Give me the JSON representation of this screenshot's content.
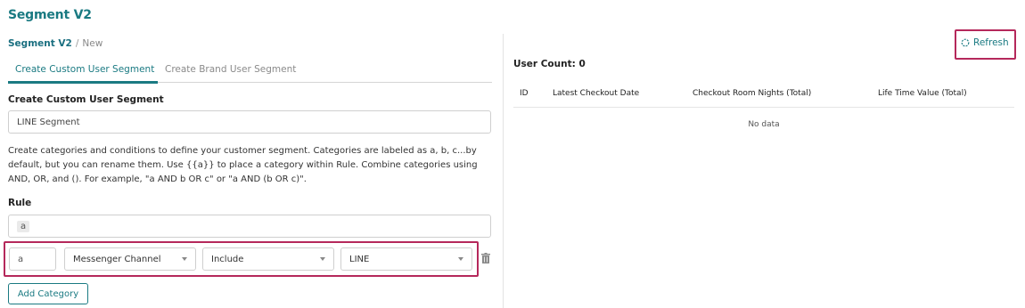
{
  "page_title": "Segment V2",
  "breadcrumb": {
    "parent": "Segment V2",
    "separator": "/",
    "current": "New"
  },
  "tabs": [
    {
      "label": "Create Custom User Segment",
      "active": true
    },
    {
      "label": "Create Brand User Segment",
      "active": false
    }
  ],
  "form": {
    "section_title": "Create Custom User Segment",
    "segment_name_value": "LINE Segment",
    "help_text": "Create categories and conditions to define your customer segment. Categories are labeled as a, b, c...by default, but you can rename them. Use {{a}} to place a category within Rule. Combine categories using AND, OR, and (). For example, \"a AND b OR c\" or \"a AND (b OR c)\".",
    "rule_label": "Rule",
    "rule_value": "a",
    "category": {
      "name": "a",
      "field": "Messenger Channel",
      "operator": "Include",
      "value": "LINE"
    },
    "add_category_label": "Add Category"
  },
  "results": {
    "refresh_label": "Refresh",
    "user_count": "User Count: 0",
    "columns": [
      "ID",
      "Latest Checkout Date",
      "Checkout Room Nights (Total)",
      "Life Time Value (Total)"
    ],
    "empty_text": "No data"
  },
  "colors": {
    "brand": "#1a7a82",
    "highlight": "#b5285b"
  }
}
